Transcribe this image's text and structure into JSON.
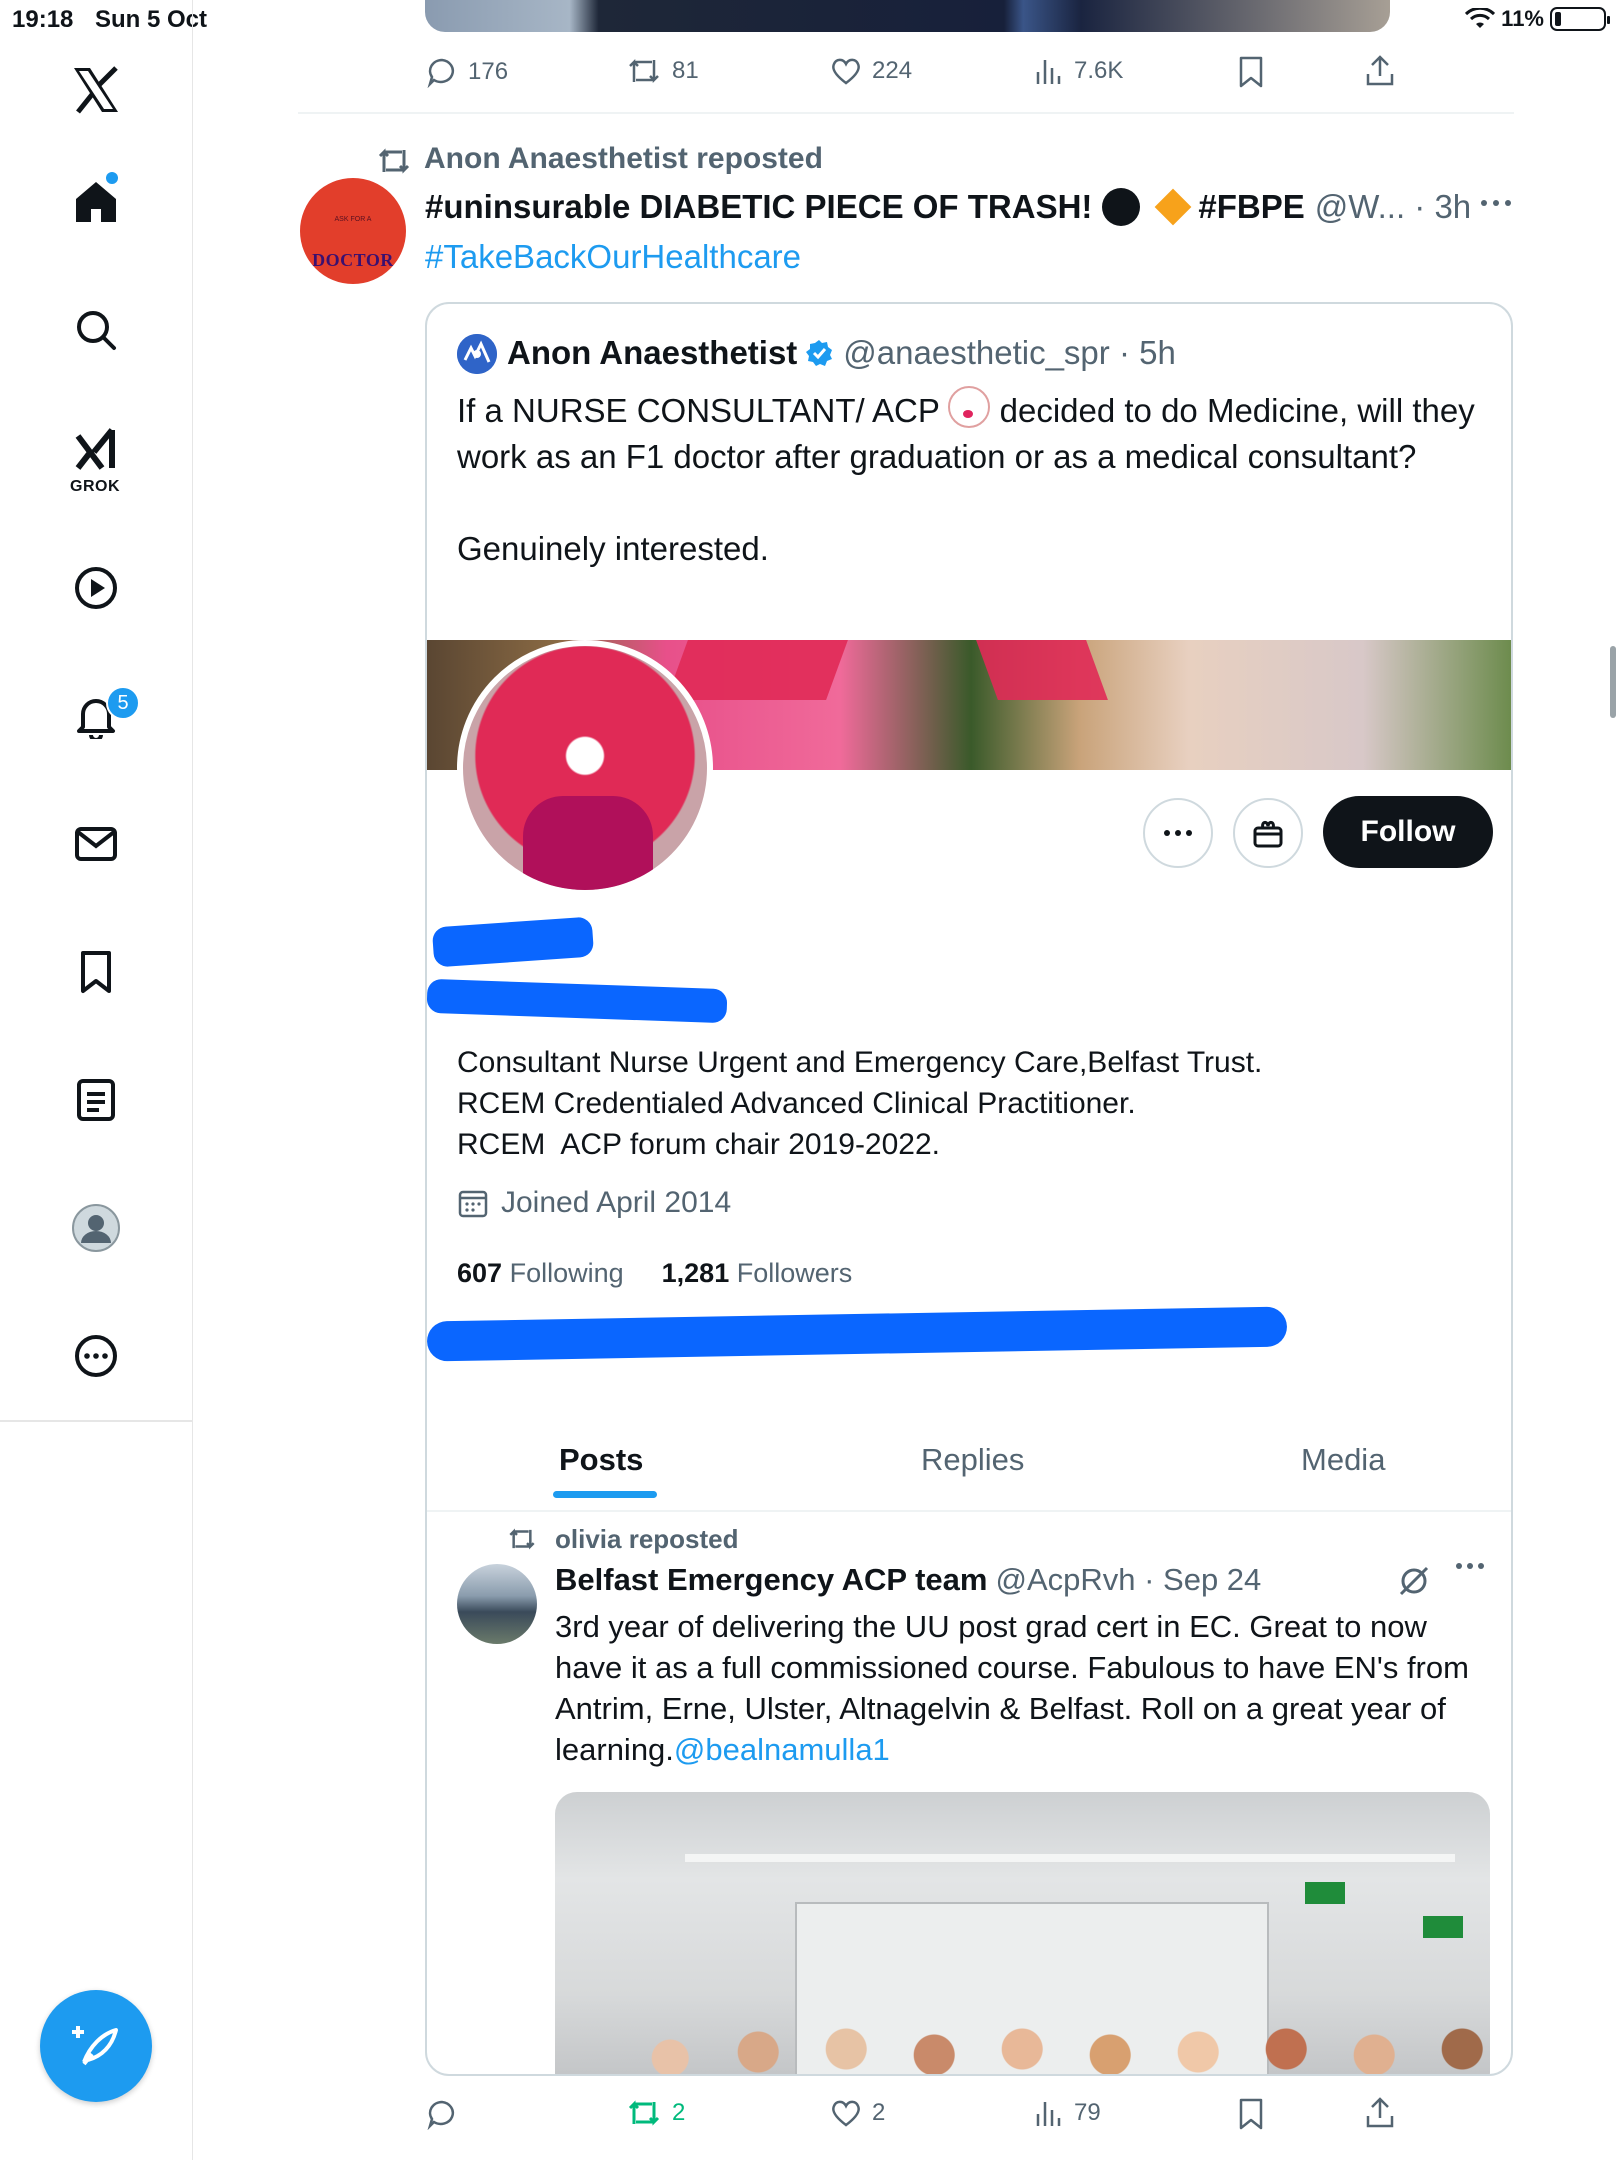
{
  "status_bar": {
    "time": "19:18",
    "date": "Sun 5 Oct",
    "battery": "11%",
    "battery_level": 0.11
  },
  "sidebar": {
    "app_logo": "x-logo-icon",
    "items": [
      {
        "name": "home",
        "icon": "home-icon"
      },
      {
        "name": "search",
        "icon": "search-icon"
      },
      {
        "name": "grok",
        "icon": "grok-icon",
        "label": "GROK"
      },
      {
        "name": "videos",
        "icon": "play-icon"
      },
      {
        "name": "notifications",
        "icon": "bell-icon",
        "badge": "5"
      },
      {
        "name": "messages",
        "icon": "mail-icon"
      },
      {
        "name": "bookmarks",
        "icon": "bookmark-icon"
      },
      {
        "name": "lists",
        "icon": "list-icon"
      },
      {
        "name": "profile",
        "icon": "avatar"
      },
      {
        "name": "more",
        "icon": "more-icon"
      }
    ],
    "compose_icon": "compose-icon"
  },
  "prev_post": {
    "actions": {
      "replies": "176",
      "reposts": "81",
      "likes": "224",
      "views": "7.6K"
    }
  },
  "post": {
    "repost_label": "Anon Anaesthetist reposted",
    "avatar": {
      "small_text": "ASK FOR A",
      "big_text": "DOCTOR"
    },
    "author_name_part1": "#uninsurable DIABETIC PIECE OF TRASH!",
    "author_name_part2": "#FBPE",
    "handle_time": "@W... · 3h",
    "hashtag": "#TakeBackOurHealthcare",
    "quote": {
      "author_name": "Anon Anaesthetist",
      "handle_time": "@anaesthetic_spr · 5h",
      "text_before_emoji": "If a NURSE CONSULTANT/ ACP ",
      "text_after_emoji": " decided to do Medicine, will they work as an F1 doctor after graduation or as a medical consultant?\n\nGenuinely interested.",
      "profile": {
        "follow_label": "Follow",
        "bio": "Consultant Nurse Urgent and Emergency Care,Belfast Trust.\nRCEM Credentialed Advanced Clinical Practitioner.\nRCEM  ACP forum chair 2019-2022.",
        "joined": "Joined April 2014",
        "following_count": "607",
        "following_label": "Following",
        "followers_count": "1,281",
        "followers_label": "Followers",
        "tabs": [
          "Posts",
          "Replies",
          "Media"
        ],
        "active_tab": "Posts",
        "inner_post": {
          "repost_label": "olivia reposted",
          "author_name": "Belfast Emergency ACP team",
          "handle_time": "@AcpRvh · Sep 24",
          "text": "3rd year of delivering the UU post grad cert in EC. Great to now have it as a full commissioned course. Fabulous to have EN's from Antrim, Erne, Ulster, Altnagelvin & Belfast. Roll on a great year of learning.",
          "mention": "@bealnamulla1"
        }
      }
    },
    "actions": {
      "replies": "",
      "reposts": "2",
      "likes": "2",
      "views": "79"
    }
  },
  "colors": {
    "accent": "#1d9bf0",
    "repost_active": "#00ba7c",
    "text": "#0f1419",
    "muted": "#536471"
  }
}
